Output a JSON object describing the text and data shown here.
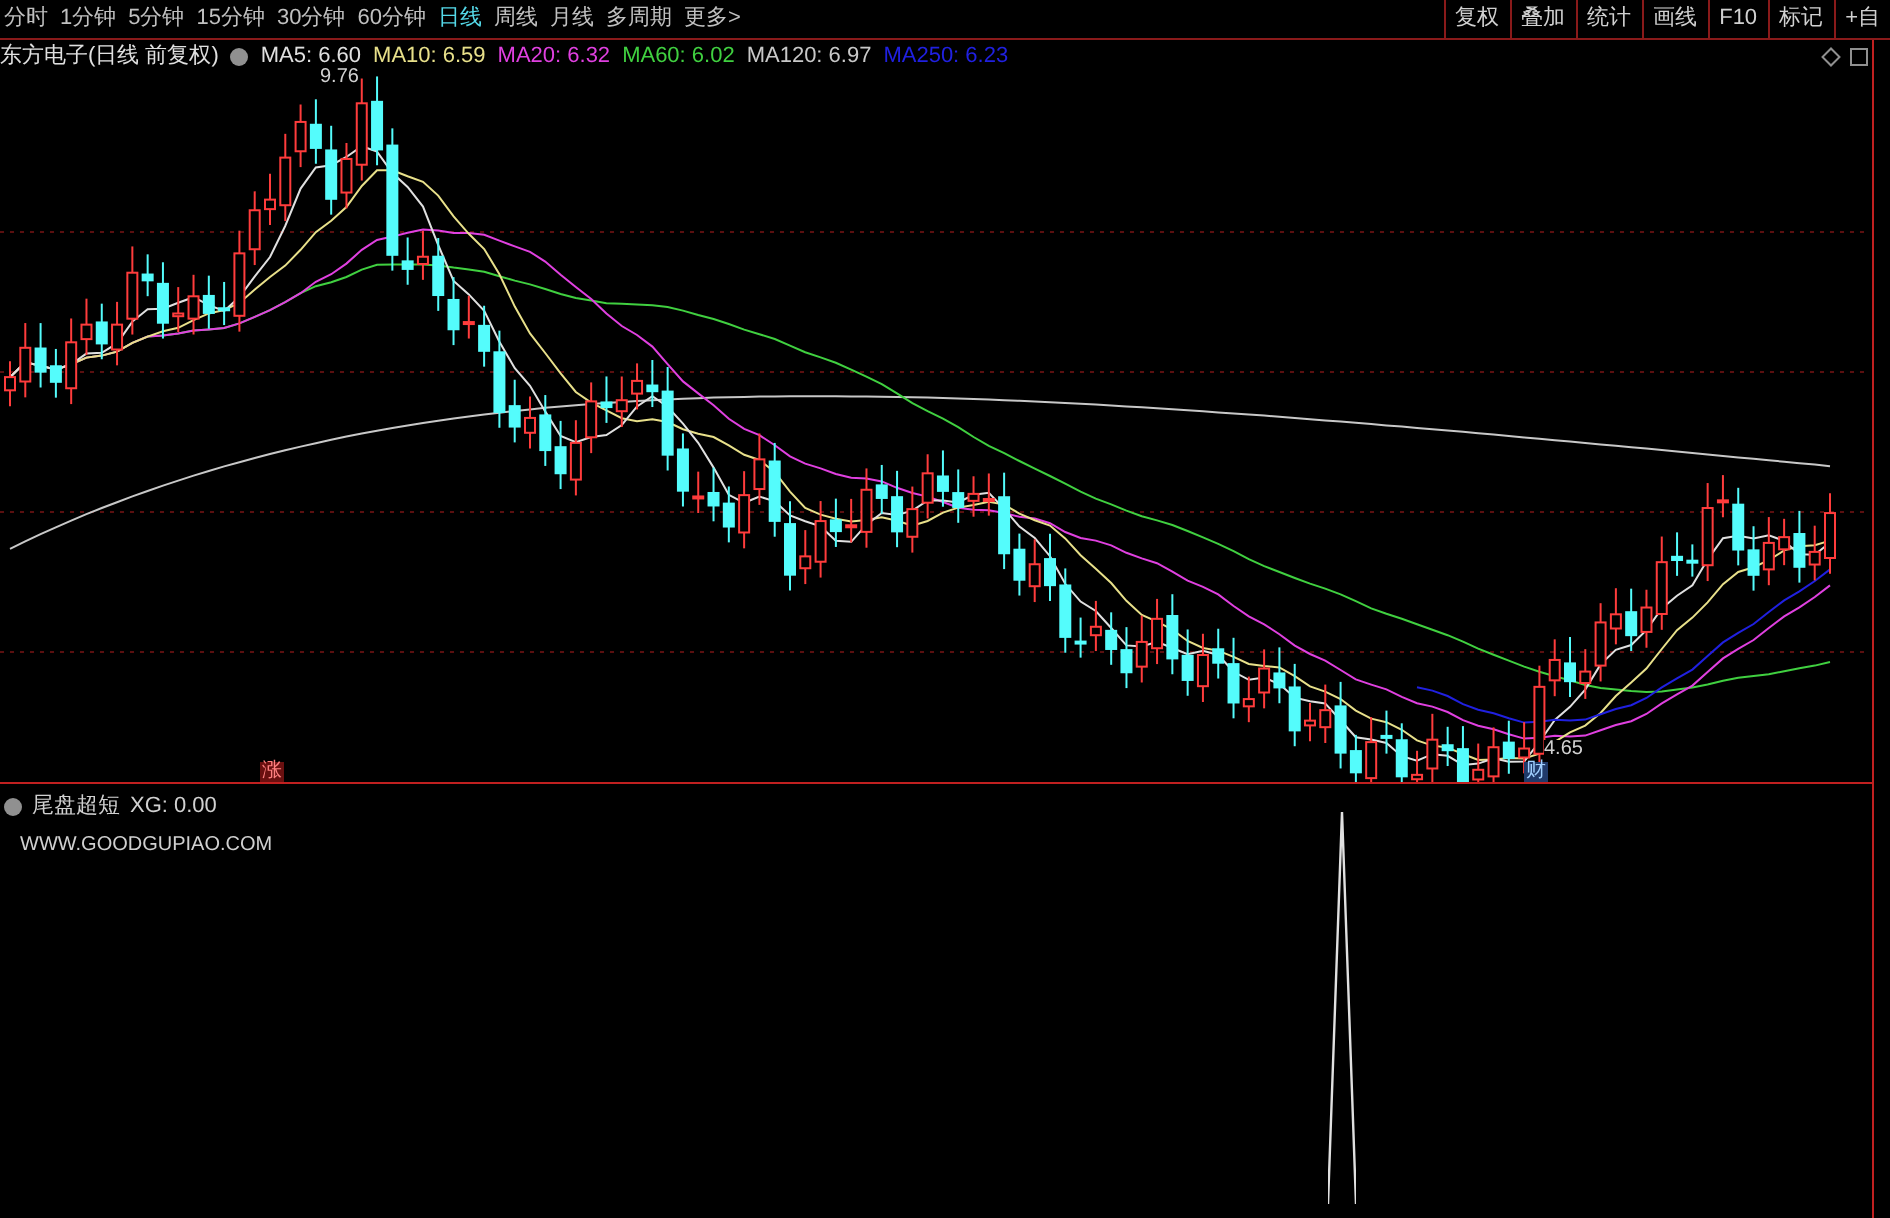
{
  "period_tabs": [
    {
      "label": "分时",
      "selected": false
    },
    {
      "label": "1分钟",
      "selected": false
    },
    {
      "label": "5分钟",
      "selected": false
    },
    {
      "label": "15分钟",
      "selected": false
    },
    {
      "label": "30分钟",
      "selected": false
    },
    {
      "label": "60分钟",
      "selected": false
    },
    {
      "label": "日线",
      "selected": true
    },
    {
      "label": "周线",
      "selected": false
    },
    {
      "label": "月线",
      "selected": false
    },
    {
      "label": "多周期",
      "selected": false
    },
    {
      "label": "更多>",
      "selected": false
    }
  ],
  "tool_buttons": [
    "复权",
    "叠加",
    "统计",
    "画线",
    "F10",
    "标记",
    "+自"
  ],
  "main_chart": {
    "title": "东方电子(日线 前复权)",
    "legend": [
      {
        "label": "MA5: 6.60",
        "color": "#e0e0e0"
      },
      {
        "label": "MA10: 6.59",
        "color": "#e8e08a"
      },
      {
        "label": "MA20: 6.32",
        "color": "#e040e0"
      },
      {
        "label": "MA60: 6.02",
        "color": "#40d040"
      },
      {
        "label": "MA120: 6.97",
        "color": "#c8c8c8"
      },
      {
        "label": "MA250: 6.23",
        "color": "#2020e0"
      }
    ],
    "high_label": "9.76",
    "low_label": "4.65",
    "marker_rise": "涨",
    "marker_finance": "财"
  },
  "indicator": {
    "title": "尾盘超短",
    "reading": "XG: 0.00",
    "note": "WWW.GOODGUPIAO.COM"
  }
}
